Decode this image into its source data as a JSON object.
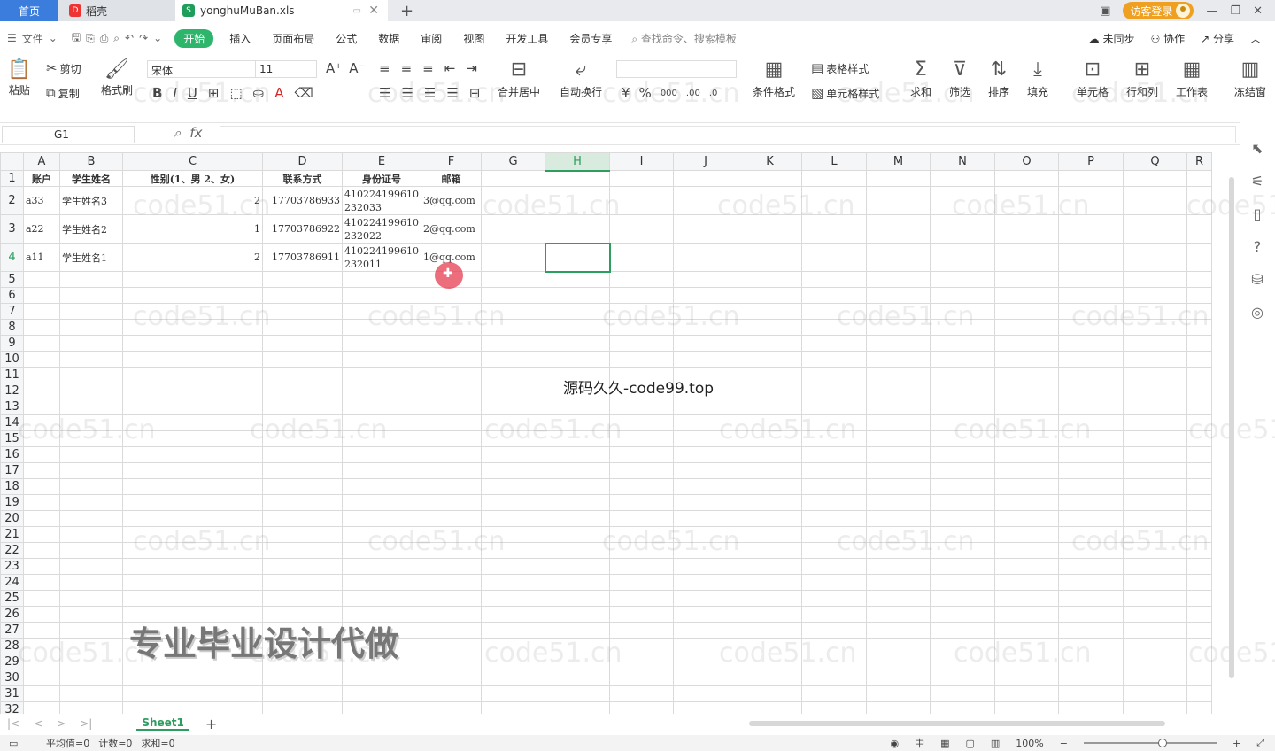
{
  "titlebar": {
    "tabs": [
      {
        "label": "首页",
        "icon": ""
      },
      {
        "label": "稻壳",
        "icon": "D"
      },
      {
        "label": "yonghuMuBan.xls",
        "icon": "S"
      }
    ],
    "visitor_label": "访客登录"
  },
  "menu": {
    "file_label": "文件",
    "tabs": [
      "开始",
      "插入",
      "页面布局",
      "公式",
      "数据",
      "审阅",
      "视图",
      "开发工具",
      "会员专享"
    ],
    "search_placeholder": "查找命令、搜索模板",
    "right": [
      "未同步",
      "协作",
      "分享"
    ]
  },
  "ribbon": {
    "paste": "粘贴",
    "cut": "剪切",
    "copy": "复制",
    "format_painter": "格式刷",
    "font_name": "宋体",
    "font_size": "11",
    "merge_center": "合并居中",
    "wrap_text": "自动换行",
    "table_style": "表格样式",
    "cell_style": "单元格样式",
    "conditional_format": "条件格式",
    "sum": "求和",
    "filter": "筛选",
    "sort": "排序",
    "fill": "填充",
    "cell": "单元格",
    "row_col": "行和列",
    "worksheet": "工作表",
    "freeze": "冻结窗"
  },
  "formula_bar": {
    "cell_ref": "G1",
    "formula": ""
  },
  "sheet": {
    "columns": [
      "A",
      "B",
      "C",
      "D",
      "E",
      "F",
      "G",
      "H",
      "I",
      "J",
      "K",
      "L",
      "M",
      "N",
      "O",
      "P",
      "Q",
      "R"
    ],
    "selected_column": "H",
    "rows": [
      [
        "账户",
        "学生姓名",
        "性别(1、男 2、女)",
        "联系方式",
        "身份证号",
        "邮箱"
      ],
      [
        "a33",
        "学生姓名3",
        "2",
        "17703786933",
        "410224199610 232033",
        "3@qq.com"
      ],
      [
        "a22",
        "学生姓名2",
        "1",
        "17703786922",
        "410224199610 232022",
        "2@qq.com"
      ],
      [
        "a11",
        "学生姓名1",
        "2",
        "17703786911",
        "410224199610 232011",
        "1@qq.com"
      ]
    ],
    "row_numbers": [
      "1",
      "2",
      "3",
      "4",
      "5",
      "6",
      "7",
      "8",
      "9",
      "10",
      "11",
      "12",
      "13",
      "14",
      "15",
      "16",
      "17",
      "18",
      "19",
      "20",
      "21",
      "22",
      "23",
      "24",
      "25",
      "26",
      "27",
      "28",
      "29",
      "30",
      "31",
      "32"
    ]
  },
  "watermark_text": "code51.cn",
  "overlay_text": "源码久久-code99.top",
  "banner_text": "专业毕业设计代做",
  "sheet_tabs": [
    "Sheet1"
  ],
  "status": {
    "average": "平均值=0",
    "count": "计数=0",
    "sum": "求和=0",
    "zoom": "100%"
  }
}
